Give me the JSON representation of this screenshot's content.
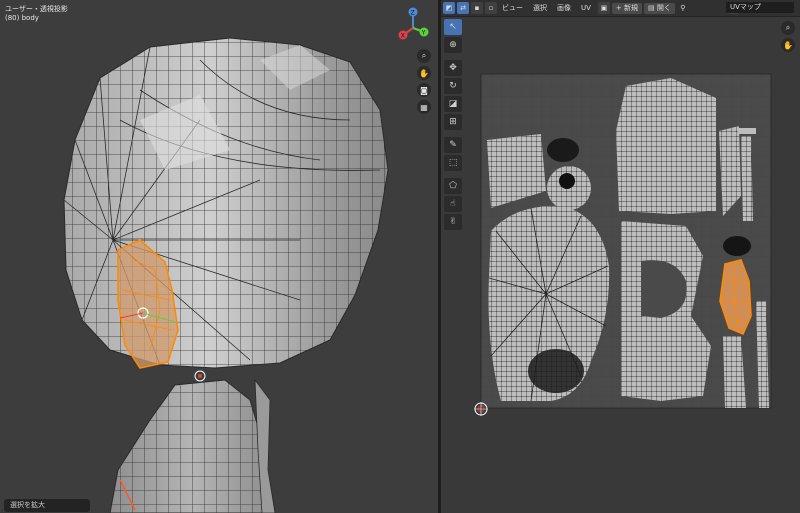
{
  "viewport": {
    "view_label": "ユーザー・透視投影",
    "object_label": "(80) body",
    "status_text": "選択を拡大",
    "gizmo_axes": {
      "x": "X",
      "y": "Y",
      "z": "Z"
    },
    "nav_icons": [
      "zoom-icon",
      "hand-icon",
      "camera-icon",
      "grid-icon"
    ]
  },
  "uv_editor": {
    "menus": [
      "ビュー",
      "選択",
      "画像",
      "UV"
    ],
    "new_label": "新規",
    "open_label": "開く",
    "uv_map_name": "UVマップ",
    "colors": {
      "selection": "#ff8a00",
      "mesh_face": "#bdbdbd",
      "grid_bg": "#4a4a4a",
      "active_tool": "#4772b3"
    }
  }
}
